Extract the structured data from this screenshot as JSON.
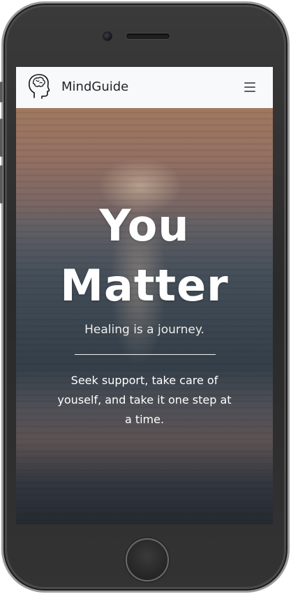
{
  "navbar": {
    "brand_name": "MindGuide",
    "brand_icon": "brain-head-icon",
    "menu_icon": "hamburger-menu-icon"
  },
  "hero": {
    "title_line1": "You",
    "title_line2": "Matter",
    "subtitle": "Healing is a journey.",
    "body": "Seek support, take care of youself, and take it one step at a time."
  },
  "colors": {
    "navbar_bg": "#f8f9fa",
    "text_light": "#ffffff",
    "brand_text": "#212529"
  }
}
